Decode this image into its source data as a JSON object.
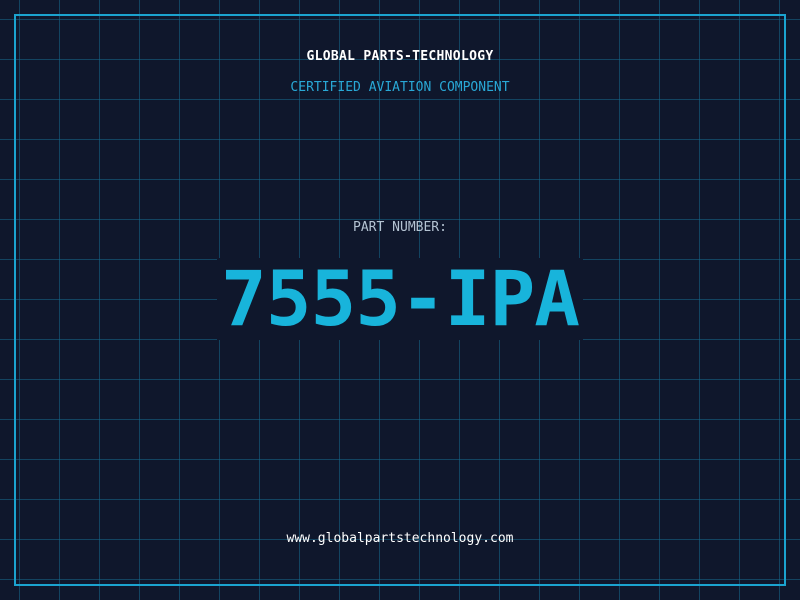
{
  "header": {
    "company": "GLOBAL PARTS-TECHNOLOGY",
    "tagline": "CERTIFIED AVIATION COMPONENT"
  },
  "part": {
    "label": "PART NUMBER:",
    "number": "7555-IPA"
  },
  "footer": {
    "website": "www.globalpartstechnology.com"
  },
  "colors": {
    "background": "#0f172c",
    "grid": "#166a8c",
    "accent": "#18b4db",
    "frame": "#1ba3cf"
  }
}
